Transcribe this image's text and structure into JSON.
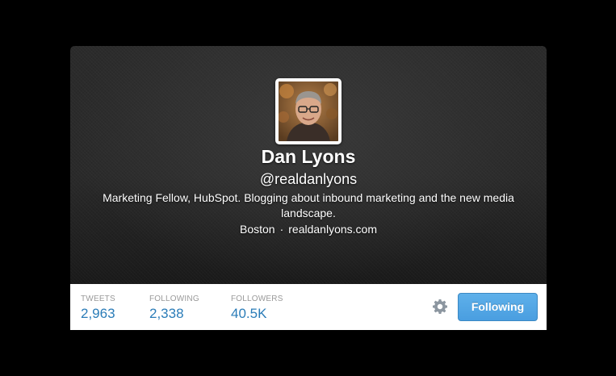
{
  "profile": {
    "name": "Dan Lyons",
    "handle": "@realdanlyons",
    "bio": "Marketing Fellow, HubSpot. Blogging about inbound marketing and the new media landscape.",
    "location": "Boston",
    "separator": "·",
    "website": "realdanlyons.com"
  },
  "stats": {
    "tweets": {
      "label": "TWEETS",
      "value": "2,963"
    },
    "following": {
      "label": "FOLLOWING",
      "value": "2,338"
    },
    "followers": {
      "label": "FOLLOWERS",
      "value": "40.5K"
    }
  },
  "actions": {
    "settings_icon": "gear-icon",
    "follow_button_label": "Following"
  },
  "colors": {
    "page_background": "#000000",
    "header_background": "#2a2a2a",
    "stat_value": "#2a7cb8",
    "stat_label": "#999999",
    "button_blue": "#4a9ee0"
  }
}
